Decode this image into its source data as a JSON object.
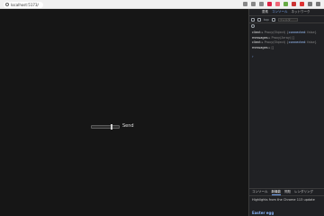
{
  "browser": {
    "url": "localhost:5173/",
    "toolbar_icons": [
      "translate-icon",
      "zoom-icon",
      "star-icon",
      "extension-icon",
      "extension-icon",
      "extension-icon",
      "extension-icon",
      "extension-icon",
      "profile-icon",
      "menu-icon"
    ]
  },
  "page": {
    "send_label": "Send"
  },
  "devtools": {
    "tabs": [
      "要素",
      "コンソール",
      "ネットワーク"
    ],
    "active_tab": 1,
    "context": "top",
    "filter_placeholder": "フィルタ",
    "logs": [
      {
        "name": "client",
        "muted": " ▸ Proxy(Object) {",
        "fn": "connected",
        "tail": ": false}"
      },
      {
        "name": "messages",
        "muted": " ▸ Proxy(Array) [] ",
        "fn": "",
        "tail": ""
      },
      {
        "name": "client",
        "muted": " ▸ Proxy(Object) {",
        "fn": "connected",
        "tail": ": false}"
      },
      {
        "name": "messages",
        "muted": " ▸ [] ",
        "fn": "",
        "tail": ""
      }
    ],
    "prompt": "›"
  },
  "drawer": {
    "tabs": [
      "コンソール",
      "新機能",
      "問題",
      "レンダリング"
    ],
    "active_tab": 1,
    "headline": "Highlights from the Chrome 113 update",
    "link": "Easter egg"
  },
  "colors": {
    "accent": "#7cacf8",
    "page_bg": "#161616",
    "devtools_bg": "#202124"
  }
}
